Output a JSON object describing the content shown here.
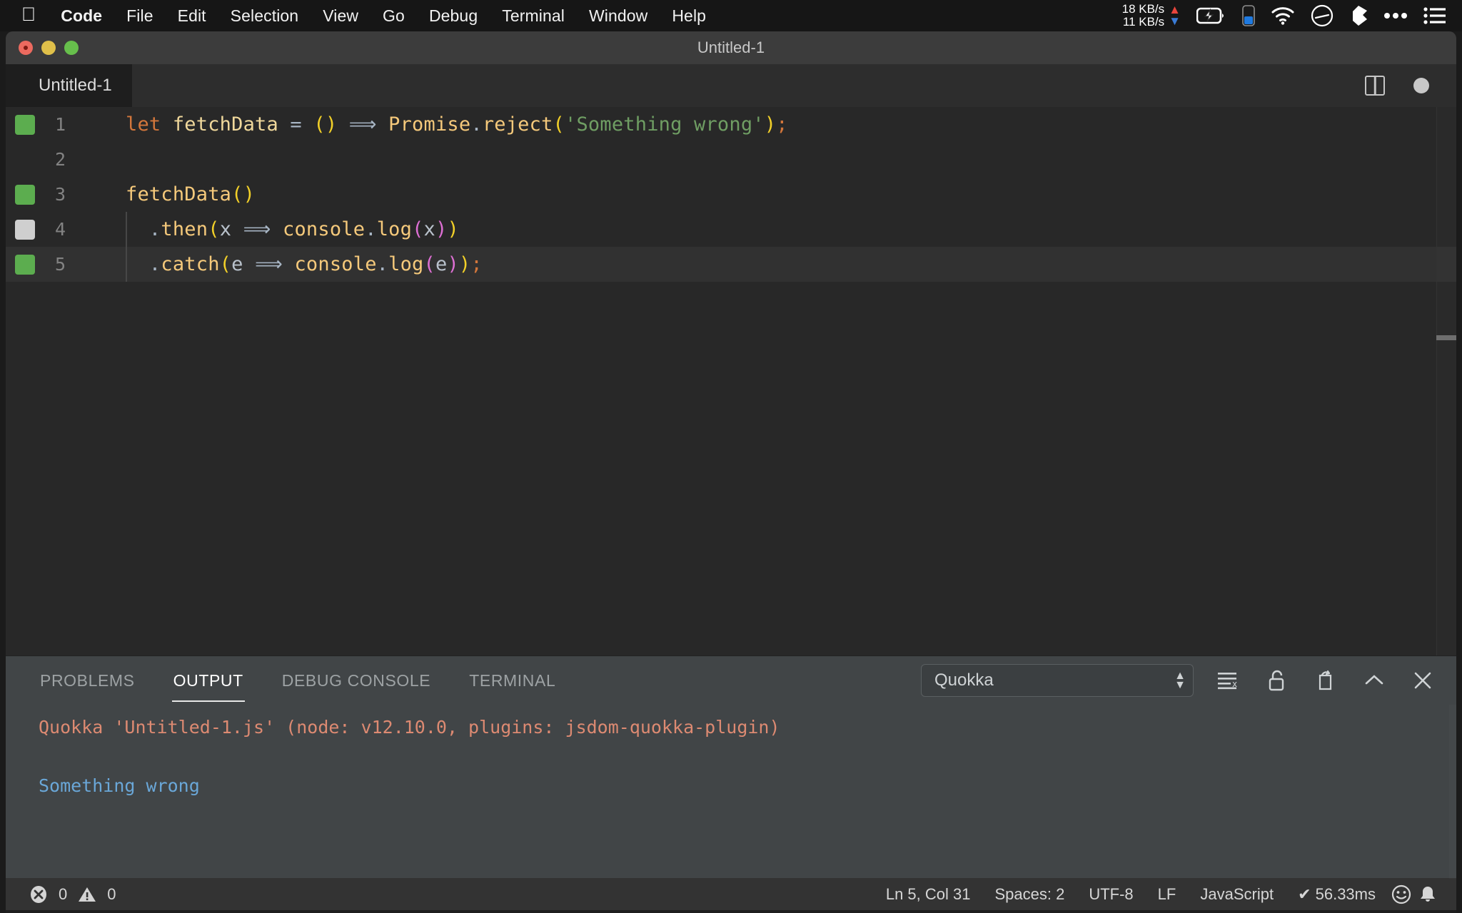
{
  "menubar": {
    "apple_icon": "apple-logo-icon",
    "items": [
      {
        "label": "Code",
        "bold": true
      },
      {
        "label": "File",
        "bold": false
      },
      {
        "label": "Edit",
        "bold": false
      },
      {
        "label": "Selection",
        "bold": false
      },
      {
        "label": "View",
        "bold": false
      },
      {
        "label": "Go",
        "bold": false
      },
      {
        "label": "Debug",
        "bold": false
      },
      {
        "label": "Terminal",
        "bold": false
      },
      {
        "label": "Window",
        "bold": false
      },
      {
        "label": "Help",
        "bold": false
      }
    ],
    "network": {
      "upload": "18 KB/s",
      "download": "11 KB/s",
      "up_arrow_color": "#e8453c",
      "down_arrow_color": "#3a7bd5"
    },
    "tray": [
      "battery-charging-icon",
      "phone-battery-icon",
      "wifi-icon",
      "speedometer-icon",
      "dropbox-icon",
      "ellipsis-icon",
      "control-center-list-icon"
    ]
  },
  "window": {
    "title": "Untitled-1",
    "traffic_lights": [
      "close-button",
      "minimize-button",
      "maximize-button"
    ]
  },
  "editor": {
    "tab_label": "Untitled-1",
    "split_icon": "split-editor-icon",
    "dirty_indicator": "unsaved-changes-dot",
    "coverage_color_covered": "#5cad4f",
    "coverage_color_uncovered": "#cfcfcf",
    "lines": [
      {
        "number": "1",
        "coverage": "covered",
        "current": false,
        "tokens": [
          {
            "text": "let",
            "type": "key"
          },
          {
            "text": " ",
            "type": "plain"
          },
          {
            "text": "fetchData",
            "type": "var"
          },
          {
            "text": " ",
            "type": "plain"
          },
          {
            "text": "=",
            "type": "op"
          },
          {
            "text": " ",
            "type": "plain"
          },
          {
            "text": "()",
            "type": "par-y"
          },
          {
            "text": " ",
            "type": "plain"
          },
          {
            "text": "⟹",
            "type": "op"
          },
          {
            "text": " ",
            "type": "plain"
          },
          {
            "text": "Promise",
            "type": "fn"
          },
          {
            "text": ".",
            "type": "punct"
          },
          {
            "text": "reject",
            "type": "fn"
          },
          {
            "text": "(",
            "type": "par-y"
          },
          {
            "text": "'Something wrong'",
            "type": "str"
          },
          {
            "text": ")",
            "type": "par-y"
          },
          {
            "text": ";",
            "type": "semi"
          }
        ]
      },
      {
        "number": "2",
        "coverage": "none",
        "current": false,
        "tokens": []
      },
      {
        "number": "3",
        "coverage": "covered",
        "current": false,
        "tokens": [
          {
            "text": "fetchData",
            "type": "fn"
          },
          {
            "text": "()",
            "type": "par-y"
          }
        ]
      },
      {
        "number": "4",
        "coverage": "uncovered",
        "current": false,
        "tokens": [
          {
            "text": "  ",
            "type": "plain"
          },
          {
            "text": ".",
            "type": "punct"
          },
          {
            "text": "then",
            "type": "fn"
          },
          {
            "text": "(",
            "type": "par-y"
          },
          {
            "text": "x",
            "type": "plain"
          },
          {
            "text": " ",
            "type": "plain"
          },
          {
            "text": "⟹",
            "type": "op"
          },
          {
            "text": " ",
            "type": "plain"
          },
          {
            "text": "console",
            "type": "fn"
          },
          {
            "text": ".",
            "type": "punct"
          },
          {
            "text": "log",
            "type": "fn"
          },
          {
            "text": "(",
            "type": "par-m"
          },
          {
            "text": "x",
            "type": "plain"
          },
          {
            "text": ")",
            "type": "par-m"
          },
          {
            "text": ")",
            "type": "par-y"
          }
        ]
      },
      {
        "number": "5",
        "coverage": "covered",
        "current": true,
        "tokens": [
          {
            "text": "  ",
            "type": "plain"
          },
          {
            "text": ".",
            "type": "punct"
          },
          {
            "text": "catch",
            "type": "fn"
          },
          {
            "text": "(",
            "type": "par-y"
          },
          {
            "text": "e",
            "type": "plain"
          },
          {
            "text": " ",
            "type": "plain"
          },
          {
            "text": "⟹",
            "type": "op"
          },
          {
            "text": " ",
            "type": "plain"
          },
          {
            "text": "console",
            "type": "fn"
          },
          {
            "text": ".",
            "type": "punct"
          },
          {
            "text": "log",
            "type": "fn"
          },
          {
            "text": "(",
            "type": "par-m"
          },
          {
            "text": "e",
            "type": "plain"
          },
          {
            "text": ")",
            "type": "par-m"
          },
          {
            "text": ")",
            "type": "par-y"
          },
          {
            "text": ";",
            "type": "semi"
          }
        ]
      }
    ]
  },
  "panel": {
    "tabs": [
      {
        "label": "PROBLEMS",
        "active": false
      },
      {
        "label": "OUTPUT",
        "active": true
      },
      {
        "label": "DEBUG CONSOLE",
        "active": false
      },
      {
        "label": "TERMINAL",
        "active": false
      }
    ],
    "channel_select": {
      "value": "Quokka",
      "options": [
        "Quokka"
      ]
    },
    "actions": [
      "clear-output-icon",
      "lock-scroll-icon",
      "open-in-editor-icon",
      "maximize-panel-icon",
      "close-panel-icon"
    ],
    "output": {
      "header": "Quokka 'Untitled-1.js' (node: v12.10.0, plugins: jsdom-quokka-plugin)",
      "header_color": "#dd8a72",
      "value": "Something wrong",
      "value_color": "#6aa7d8"
    }
  },
  "statusbar": {
    "errors_icon": "error-circle-icon",
    "errors": "0",
    "warnings_icon": "warning-triangle-icon",
    "warnings": "0",
    "cursor_position": "Ln 5, Col 31",
    "indentation": "Spaces: 2",
    "encoding": "UTF-8",
    "eol": "LF",
    "language": "JavaScript",
    "run_time": "✔ 56.33ms",
    "feedback_icon": "smiley-icon",
    "notifications_icon": "bell-icon"
  }
}
